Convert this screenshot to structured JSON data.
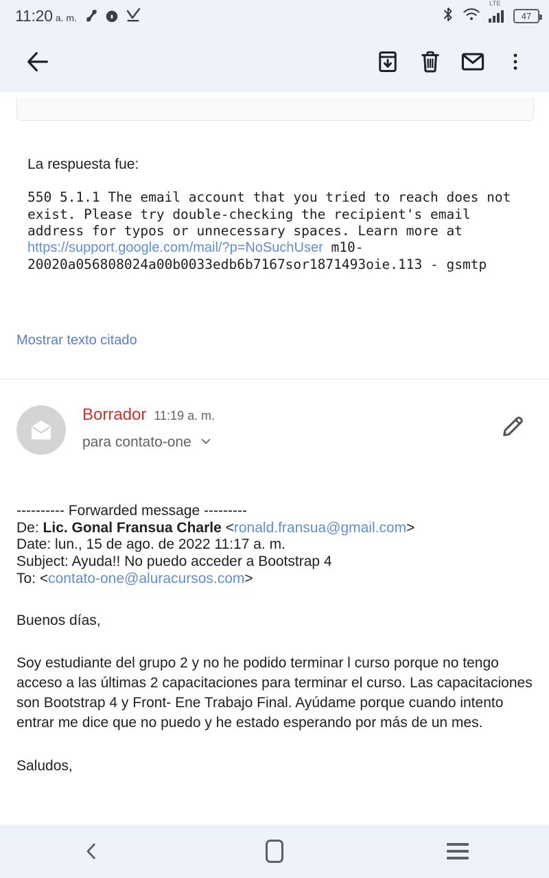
{
  "status_bar": {
    "time": "11:20",
    "ampm": "a. m.",
    "left_icons": [
      "percent-data-saver-icon",
      "do-not-disturb-icon",
      "download-complete-icon"
    ],
    "network_label": "LTE",
    "right_icons": [
      "bluetooth-icon",
      "wifi-icon",
      "cellular-signal-icon"
    ],
    "battery_percent": "47",
    "background_color": "#eef2fb"
  },
  "toolbar": {
    "back_label": "back-arrow",
    "archive_label": "Archivar",
    "delete_label": "Eliminar",
    "unread_label": "Marcar como no leido",
    "more_label": "Mas opciones",
    "background_color": "#eef2fb"
  },
  "bounce": {
    "lead": "La respuesta fue:",
    "detail_before_link": "550 5.1.1 The email account that you tried to reach does not exist. Please try double-checking the recipient's email address for typos or unnecessary spaces. Learn more at ",
    "link_text": "https://support.google.com/mail/?p=NoSuchUser",
    "detail_after_link": " m10-20020a056808024a00b0033edb6b7167sor1871493oie.113 - gsmtp",
    "show_quoted": "Mostrar texto citado",
    "link_color": "#5f8fd4"
  },
  "draft": {
    "label": "Borrador",
    "label_color": "#c5362c",
    "time": "11:19 a. m.",
    "recipient": "para contato-one",
    "expand_icon": "chevron-down-icon",
    "avatar_icon": "envelope-icon",
    "edit_icon": "pencil-icon"
  },
  "forwarded": {
    "rule": "---------- Forwarded message ---------",
    "from_label": "De:",
    "from_name": "Lic. Gonal Fransua Charle",
    "from_email": "ronald.fransua@gmail.com",
    "date_line": "Date: lun., 15 de ago. de 2022 11:17 a. m.",
    "subject_line": "Subject: Ayuda!! No puedo acceder a Bootstrap 4",
    "to_label": "To:",
    "to_email": "contato-one@aluracursos.com"
  },
  "message": {
    "greeting": "Buenos días,",
    "paragraph": "Soy estudiante del grupo 2 y no he podido terminar l curso porque no tengo acceso a las últimas 2 capacitaciones para terminar el curso. Las capacitaciones son Bootstrap 4 y Front- Ene Trabajo Final. Ayúdame porque cuando intento entrar me dice que no puedo y he estado esperando por más de un mes.",
    "closing": "Saludos,"
  },
  "navbar": {
    "back_label": "back-nav",
    "home_label": "home-nav",
    "recents_label": "recents-nav",
    "background_color": "#eef2fb"
  }
}
